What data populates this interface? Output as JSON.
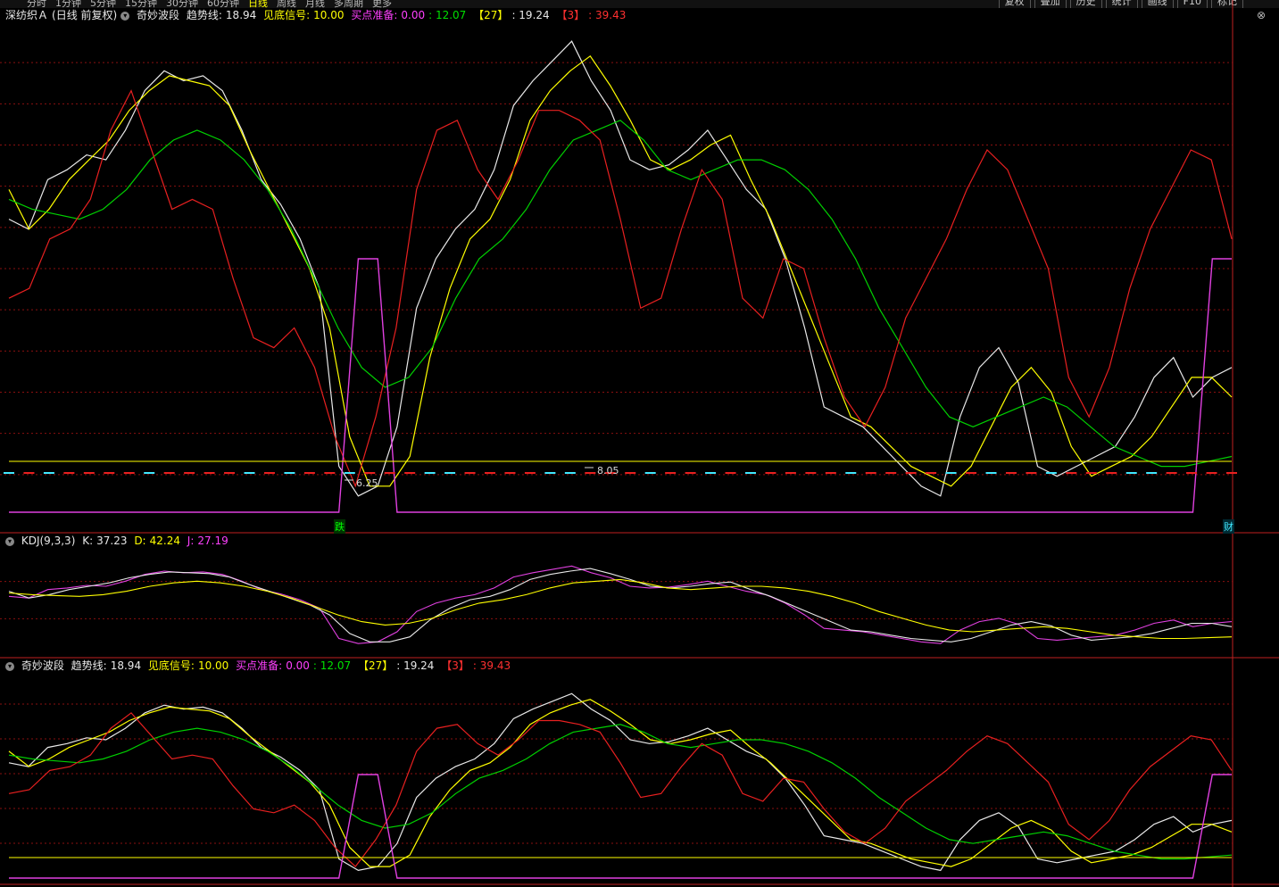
{
  "toolbar": {
    "periods": [
      "分时",
      "1分钟",
      "5分钟",
      "15分钟",
      "30分钟",
      "60分钟",
      "日线",
      "周线",
      "月线",
      "多周期",
      "更多"
    ],
    "active_period": "日线",
    "buttons": [
      "复权",
      "叠加",
      "历史",
      "统计",
      "画线",
      "F10",
      "标记"
    ]
  },
  "main_panel": {
    "stock_name": "深纺织Ａ",
    "adjust": "(日线 前复权)",
    "indicator": "奇妙波段",
    "trend_label": "趋势线:",
    "trend_value": "18.94",
    "bottom_label": "见底信号:",
    "bottom_value": "10.00",
    "buy_label": "买点准备:",
    "buy_value": "0.00",
    "buy_value2": ": 12.07",
    "b27_label": "【27】",
    "b27_value": ": 19.24",
    "b3_label": "【3】",
    "b3_value": ": 39.43",
    "low_price": "6.25",
    "high_price": "8.05",
    "fall_tag": "跌",
    "fin_tag": "财",
    "close_icon": "⊗"
  },
  "kdj_panel": {
    "name": "KDJ(9,3,3)",
    "k_label": "K:",
    "k_value": "37.23",
    "d_label": "D:",
    "d_value": "42.24",
    "j_label": "J:",
    "j_value": "27.19"
  },
  "lower_panel": {
    "indicator": "奇妙波段",
    "trend_label": "趋势线:",
    "trend_value": "18.94",
    "bottom_label": "见底信号:",
    "bottom_value": "10.00",
    "buy_label": "买点准备:",
    "buy_value": "0.00",
    "buy_value2": ": 12.07",
    "b27_label": "【27】",
    "b27_value": ": 19.24",
    "b3_label": "【3】",
    "b3_value": ": 39.43"
  },
  "colors": {
    "white": "#e8e8e8",
    "yellow": "#ffff00",
    "green": "#00d000",
    "red": "#e82020",
    "magenta": "#e040e0",
    "cyan": "#40e8ff",
    "grid": "#8a1010",
    "divider": "#c02020"
  },
  "chart_data": [
    {
      "type": "line",
      "name": "奇妙波段",
      "x": [
        0,
        1,
        2,
        3,
        4,
        5,
        6,
        7,
        8,
        9,
        10,
        11,
        12,
        13,
        14,
        15,
        16,
        17,
        18,
        19,
        20,
        21,
        22,
        23,
        24,
        25,
        26,
        27,
        28,
        29,
        30,
        31,
        32,
        33,
        34,
        35,
        36,
        37,
        38,
        39,
        40,
        41,
        42,
        43,
        44,
        45,
        46,
        47,
        48,
        49,
        50,
        51,
        52,
        53,
        54,
        55,
        56,
        57,
        58,
        59,
        60,
        61,
        62,
        63
      ],
      "series": [
        {
          "name": "白线",
          "color": "white",
          "values": [
            60,
            58,
            68,
            70,
            73,
            72,
            78,
            86,
            90,
            88,
            89,
            86,
            78,
            68,
            63,
            56,
            46,
            10,
            4,
            6,
            18,
            42,
            52,
            58,
            62,
            70,
            83,
            88,
            92,
            96,
            88,
            82,
            72,
            70,
            71,
            74,
            78,
            72,
            66,
            62,
            52,
            38,
            22,
            20,
            18,
            14,
            10,
            6,
            4,
            20,
            30,
            34,
            27,
            10,
            8,
            10,
            12,
            14,
            20,
            28,
            32,
            24,
            28,
            30
          ]
        },
        {
          "name": "黄线",
          "color": "yellow",
          "values": [
            66,
            58,
            62,
            68,
            72,
            76,
            82,
            86,
            89,
            88,
            87,
            83,
            74,
            66,
            58,
            50,
            38,
            16,
            6,
            6,
            12,
            32,
            46,
            56,
            60,
            68,
            80,
            86,
            90,
            93,
            87,
            80,
            72,
            70,
            72,
            75,
            77,
            68,
            60,
            50,
            40,
            30,
            20,
            18,
            14,
            10,
            8,
            6,
            10,
            18,
            26,
            30,
            25,
            14,
            8,
            10,
            12,
            16,
            22,
            28,
            28,
            24
          ]
        },
        {
          "name": "绿线",
          "color": "green",
          "values": [
            64,
            62,
            61,
            60,
            62,
            66,
            72,
            76,
            78,
            76,
            72,
            66,
            58,
            48,
            38,
            30,
            26,
            28,
            34,
            44,
            52,
            56,
            62,
            70,
            76,
            78,
            80,
            76,
            70,
            68,
            70,
            72,
            72,
            70,
            66,
            60,
            52,
            42,
            34,
            26,
            20,
            18,
            20,
            22,
            24,
            22,
            18,
            14,
            12,
            10,
            10,
            11,
            12
          ]
        },
        {
          "name": "红线",
          "color": "red",
          "values": [
            44,
            46,
            56,
            58,
            64,
            78,
            86,
            74,
            62,
            64,
            62,
            48,
            36,
            34,
            38,
            30,
            16,
            6,
            20,
            38,
            66,
            78,
            80,
            70,
            64,
            72,
            82,
            82,
            80,
            76,
            60,
            42,
            44,
            58,
            70,
            64,
            44,
            40,
            52,
            50,
            36,
            24,
            18,
            26,
            40,
            48,
            56,
            66,
            74,
            70,
            60,
            50,
            28,
            20,
            30,
            46,
            58,
            66,
            74,
            72,
            56
          ]
        }
      ],
      "signal": {
        "name": "紫线",
        "color": "magenta",
        "x": [
          0,
          17,
          18,
          19,
          20,
          61,
          62,
          63
        ],
        "values": [
          0,
          0,
          1,
          1,
          0,
          0,
          1,
          1
        ]
      },
      "horizontal_line": {
        "color": "yellow",
        "value": 20
      },
      "price_markers": {
        "low": 6.25,
        "high": 8.05
      }
    },
    {
      "type": "line",
      "name": "KDJ(9,3,3)",
      "series": [
        {
          "name": "K",
          "color": "white",
          "value": 37.23
        },
        {
          "name": "D",
          "color": "yellow",
          "value": 42.24
        },
        {
          "name": "J",
          "color": "magenta",
          "value": 27.19
        }
      ]
    }
  ]
}
